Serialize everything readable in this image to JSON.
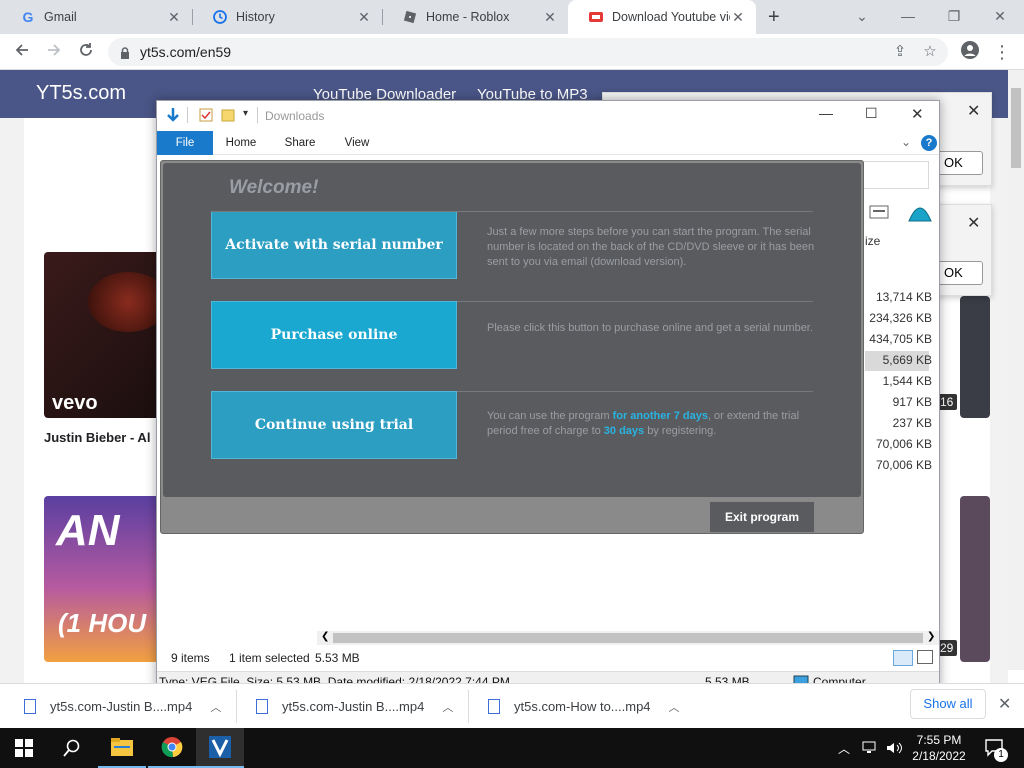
{
  "browser": {
    "tabs": [
      {
        "label": "Gmail",
        "icon": "gmail-icon"
      },
      {
        "label": "History",
        "icon": "history-icon"
      },
      {
        "label": "Home - Roblox",
        "icon": "roblox-icon"
      },
      {
        "label": "Download Youtube vid",
        "icon": "yt5s-icon"
      }
    ],
    "url": "yt5s.com/en59"
  },
  "site": {
    "logo": "YT5s.com",
    "nav": [
      "YouTube Downloader",
      "YouTube to MP3"
    ],
    "video_title": "Justin Bieber - Al",
    "vevo": "vevo",
    "badge_top": "16",
    "badge_bottom": "29",
    "ok_label": "OK",
    "thumb_text_1": "AN",
    "thumb_text_2": "(1 HOU"
  },
  "explorer": {
    "title": "Downloads",
    "ribbon_tabs": [
      "File",
      "Home",
      "Share",
      "View"
    ],
    "size_header": "ize",
    "sizes": [
      "13,714 KB",
      "234,326 KB",
      "434,705 KB",
      "5,669 KB",
      "1,544 KB",
      "917 KB",
      "237 KB",
      "70,006 KB",
      "70,006 KB"
    ],
    "status": {
      "items": "9 items",
      "selected": "1 item selected",
      "selected_size": "5.53 MB"
    },
    "info": {
      "details": "Type: VEG File, Size: 5.53 MB, Date modified: 2/18/2022 7:44 PM",
      "size": "5.53 MB",
      "location": "Computer"
    }
  },
  "welcome": {
    "title": "Welcome!",
    "buttons": [
      {
        "label": "Activate with serial number",
        "desc": "Just a few more steps before you can start the program. The serial number is located on the back of the CD/DVD sleeve or it has been sent to you via email (download version)."
      },
      {
        "label": "Purchase online",
        "desc": "Please click this button to purchase online and get a serial number."
      },
      {
        "label": "Continue using trial",
        "desc_pre": "You can use the program ",
        "desc_hi1": "for another 7 days",
        "desc_mid": ", or extend the trial period free of charge to ",
        "desc_hi2": "30 days",
        "desc_post": " by registering."
      }
    ],
    "exit": "Exit program"
  },
  "downloads_bar": {
    "items": [
      "yt5s.com-Justin B....mp4",
      "yt5s.com-Justin B....mp4",
      "yt5s.com-How to....mp4"
    ],
    "show_all": "Show all"
  },
  "taskbar": {
    "time": "7:55 PM",
    "date": "2/18/2022",
    "notifications": "1"
  },
  "colors": {
    "site_header": "#4a5687",
    "dialog_button": "#2c9ec2",
    "dialog_bg": "#595b5f",
    "explorer_file_tab": "#1979ca"
  }
}
